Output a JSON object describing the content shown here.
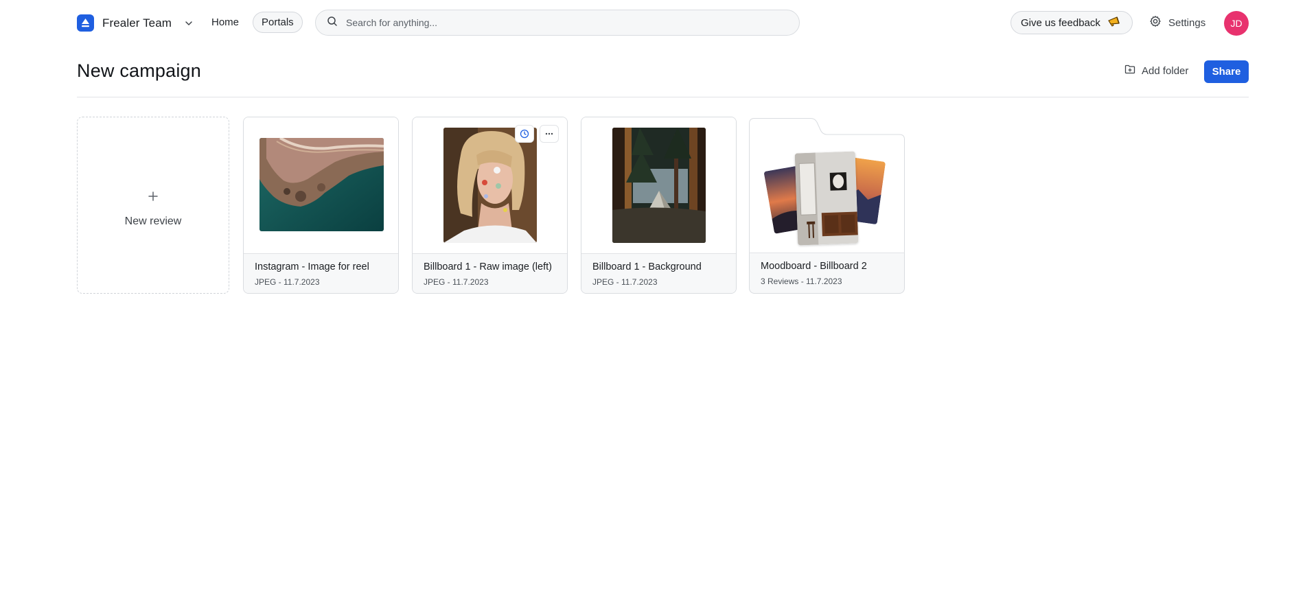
{
  "topbar": {
    "team_name": "Frealer Team",
    "nav": {
      "home": "Home",
      "portals": "Portals"
    },
    "search": {
      "placeholder": "Search for anything..."
    },
    "feedback_label": "Give us feedback",
    "settings_label": "Settings",
    "avatar_initials": "JD"
  },
  "header": {
    "title": "New campaign",
    "add_folder_label": "Add folder",
    "share_label": "Share"
  },
  "new_review": {
    "label": "New review"
  },
  "cards": [
    {
      "title": "Instagram - Image for reel",
      "meta": "JPEG - 11.7.2023"
    },
    {
      "title": "Billboard 1 - Raw image (left)",
      "meta": "JPEG - 11.7.2023"
    },
    {
      "title": "Billboard 1 - Background",
      "meta": "JPEG - 11.7.2023"
    }
  ],
  "folder": {
    "title": "Moodboard - Billboard 2",
    "meta": "3 Reviews - 11.7.2023"
  },
  "colors": {
    "accent": "#1f5fe0",
    "avatar": "#e8326e"
  },
  "icons": [
    "logo-icon",
    "chevron-down-icon",
    "search-icon",
    "megaphone-icon",
    "gear-icon",
    "folder-plus-icon",
    "plus-icon",
    "clock-icon",
    "more-icon"
  ]
}
